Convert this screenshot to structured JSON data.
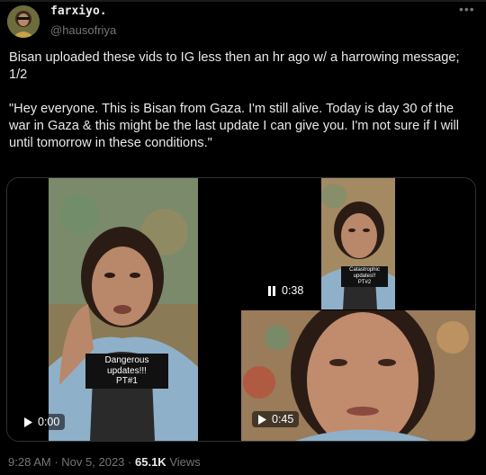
{
  "author": {
    "display_name": "farxiyo.",
    "handle": "@hausofriya",
    "more_icon": "more-horizontal-icon"
  },
  "tweet": {
    "text": "Bisan uploaded these vids to IG less then an hr ago w/ a harrowing message; 1/2\n\n\"Hey everyone. This is Bisan from Gaza. I'm still alive. Today is day 30 of the war in Gaza & this might be the last update I can give you. I'm not sure if I will until tomorrow in these conditions.\""
  },
  "media": {
    "video1": {
      "duration": "0:00",
      "icon": "play-icon",
      "sticker_line1": "Dangerous updates!!!",
      "sticker_line2": "PT#1"
    },
    "video2": {
      "duration": "0:38",
      "icon": "pause-icon",
      "sticker_line1": "Catastrophic updates!!",
      "sticker_line2": "PT#2"
    },
    "video3": {
      "duration": "0:45",
      "icon": "play-icon"
    }
  },
  "footer": {
    "time": "9:28 AM",
    "sep1": "·",
    "date": "Nov 5, 2023",
    "sep2": "·",
    "views_count": "65.1K",
    "views_label": "Views"
  },
  "colors": {
    "background": "#000000",
    "text": "#e7e9ea",
    "muted": "#71767b",
    "border": "#2f3336"
  }
}
